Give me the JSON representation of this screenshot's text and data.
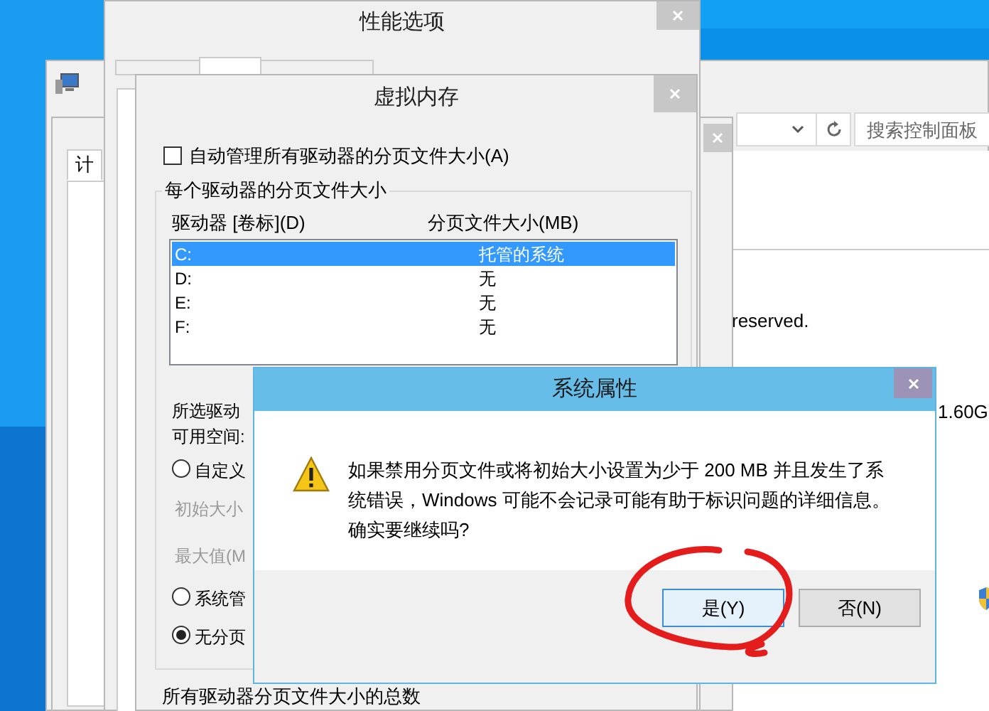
{
  "control_panel": {
    "search_placeholder": "搜索控制面板",
    "texts": [
      "reserved.",
      "1.60G"
    ]
  },
  "system_properties": {
    "tabs": [
      {
        "label": "计",
        "selected": true
      }
    ]
  },
  "performance_options": {
    "title": "性能选项",
    "tabs": [
      {
        "selected": false
      },
      {
        "selected": true
      },
      {
        "selected": false
      }
    ]
  },
  "virtual_memory": {
    "title": "虚拟内存",
    "auto_manage": {
      "label": "自动管理所有驱动器的分页文件大小(A)",
      "checked": false
    },
    "group_title": "每个驱动器的分页文件大小",
    "columns": [
      "驱动器 [卷标](D)",
      "分页文件大小(MB)"
    ],
    "drives": [
      {
        "drive": "C:",
        "size": "托管的系统",
        "selected": true
      },
      {
        "drive": "D:",
        "size": "无",
        "selected": false
      },
      {
        "drive": "E:",
        "size": "无",
        "selected": false
      },
      {
        "drive": "F:",
        "size": "无",
        "selected": false
      }
    ],
    "selected_drive_label": "所选驱动",
    "free_space_label": "可用空间:",
    "size_options": [
      {
        "kind": "radio",
        "label": "自定义",
        "selected": false
      },
      {
        "kind": "field",
        "label": "初始大小",
        "disabled": true
      },
      {
        "kind": "field",
        "label": "最大值(M",
        "disabled": true
      },
      {
        "kind": "radio",
        "label": "系统管",
        "selected": false
      },
      {
        "kind": "radio",
        "label": "无分页",
        "selected": true
      }
    ],
    "total_group_title": "所有驱动器分页文件大小的总数"
  },
  "alert": {
    "title": "系统属性",
    "message": "如果禁用分页文件或将初始大小设置为少于 200 MB 并且发生了系统错误，Windows 可能不会记录可能有助于标识问题的详细信息。确实要继续吗?",
    "buttons": [
      {
        "label": "是(Y)",
        "focused": true
      },
      {
        "label": "否(N)",
        "focused": false
      }
    ]
  }
}
